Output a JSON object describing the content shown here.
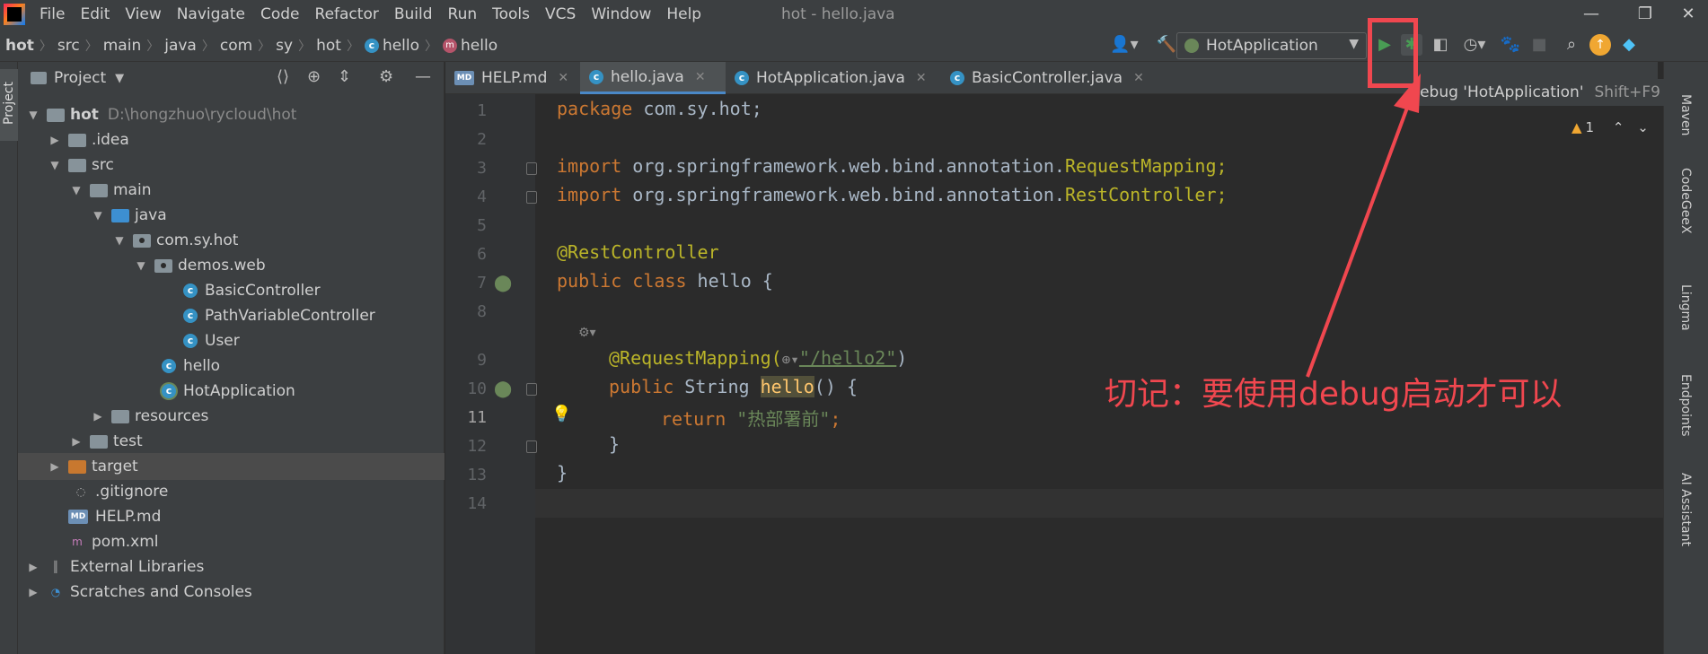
{
  "window": {
    "title": "hot - hello.java",
    "minimize": "—",
    "maximize": "❐",
    "close": "✕"
  },
  "menu": [
    "File",
    "Edit",
    "View",
    "Navigate",
    "Code",
    "Refactor",
    "Build",
    "Run",
    "Tools",
    "VCS",
    "Window",
    "Help"
  ],
  "breadcrumb": {
    "items": [
      "hot",
      "src",
      "main",
      "java",
      "com",
      "sy",
      "hot"
    ],
    "class_name": "hello",
    "method_name": "hello"
  },
  "run_config": {
    "name": "HotApplication"
  },
  "tooltip": {
    "text": "Debug 'HotApplication'",
    "shortcut": "Shift+F9"
  },
  "project": {
    "title": "Project",
    "tree": [
      {
        "label": "hot",
        "extra": "D:\\hongzhuo\\rycloud\\hot"
      },
      {
        "label": ".idea"
      },
      {
        "label": "src"
      },
      {
        "label": "main"
      },
      {
        "label": "java"
      },
      {
        "label": "com.sy.hot"
      },
      {
        "label": "demos.web"
      },
      {
        "label": "BasicController"
      },
      {
        "label": "PathVariableController"
      },
      {
        "label": "User"
      },
      {
        "label": "hello"
      },
      {
        "label": "HotApplication"
      },
      {
        "label": "resources"
      },
      {
        "label": "test"
      },
      {
        "label": "target"
      },
      {
        "label": ".gitignore"
      },
      {
        "label": "HELP.md"
      },
      {
        "label": "pom.xml"
      },
      {
        "label": "External Libraries"
      },
      {
        "label": "Scratches and Consoles"
      }
    ]
  },
  "tabs": [
    {
      "label": "HELP.md"
    },
    {
      "label": "hello.java"
    },
    {
      "label": "HotApplication.java"
    },
    {
      "label": "BasicController.java"
    }
  ],
  "editor": {
    "line_numbers": [
      "1",
      "2",
      "3",
      "4",
      "5",
      "6",
      "7",
      "8",
      "9",
      "10",
      "11",
      "12",
      "13",
      "14"
    ],
    "lines": {
      "l1_kw": "package",
      "l1_rest": " com.sy.hot;",
      "l3_kw": "import",
      "l3_pkg": " org.springframework.web.bind.annotation.",
      "l3_cls": "RequestMapping;",
      "l4_kw": "import",
      "l4_pkg": " org.springframework.web.bind.annotation.",
      "l4_cls": "RestController;",
      "l6": "@RestController",
      "l7_kw1": "public",
      "l7_kw2": " class",
      "l7_rest": " hello {",
      "l9_ann": "@RequestMapping(",
      "l9_str": "\"/hello2\"",
      "l9_end": ")",
      "l10_kw": "public",
      "l10_type": " String ",
      "l10_name": "hello",
      "l10_end": "() {",
      "l11_kw": "return",
      "l11_str": " \"热部署前\"",
      "l11_end": ";",
      "l12": "}",
      "l13": "}"
    },
    "warning_count": "1"
  },
  "right_tools": [
    "Maven",
    "CodeGeeX",
    "Lingma",
    "Endpoints",
    "AI Assistant"
  ],
  "left_tools": [
    "Project"
  ],
  "annotation": {
    "text": "切记：要使用debug启动才可以",
    "color": "#f0474f"
  }
}
